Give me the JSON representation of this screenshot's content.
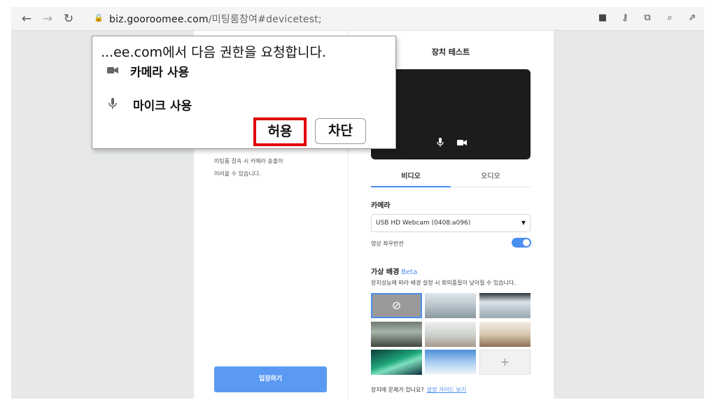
{
  "browser": {
    "url_host": "biz.gooroomee.com",
    "url_path": "/미팅룸참여#devicetest;",
    "icons": [
      "back-icon",
      "forward-icon",
      "reload-icon",
      "lock-icon",
      "camera-icon",
      "key-icon",
      "open-external-icon",
      "zoom-icon",
      "share-icon"
    ],
    "glyphs": {
      "back": "←",
      "forward": "→",
      "reload": "↻",
      "lock": "🔒",
      "camera": "■",
      "key": "⚷",
      "external": "⧉",
      "zoom": "⌕",
      "share": "⇗"
    }
  },
  "popup": {
    "title": "...ee.com에서 다음 권한을 요청합니다.",
    "permissions": [
      {
        "icon": "camera-icon",
        "label": "카메라 사용"
      },
      {
        "icon": "microphone-icon",
        "label": "마이크 사용"
      }
    ],
    "allow_label": "허용",
    "block_label": "차단",
    "highlight_color": "#e00000"
  },
  "left_panel": {
    "lines": [
      "미팅룸 접속 시 카메라 송출이",
      "어려울 수 있습니다."
    ],
    "enter_button": "입장하기"
  },
  "device_test": {
    "title": "장치 테스트",
    "tabs": [
      "비디오",
      "오디오"
    ],
    "active_tab": "비디오",
    "camera_label": "카메라",
    "camera_value": "USB HD Webcam (0408:a096)",
    "mirror_label": "영상 좌우반전",
    "mirror_enabled": true,
    "virtual_bg_title": "가상 배경",
    "virtual_bg_beta": "Beta",
    "virtual_bg_desc": "장치성능에 따라 배경 설정 시 회의품질이 낮아질 수 있습니다.",
    "help_text": "장치에 문제가 있나요?",
    "help_link": "설정 가이드 보기",
    "accent_color": "#4a8ef0"
  }
}
